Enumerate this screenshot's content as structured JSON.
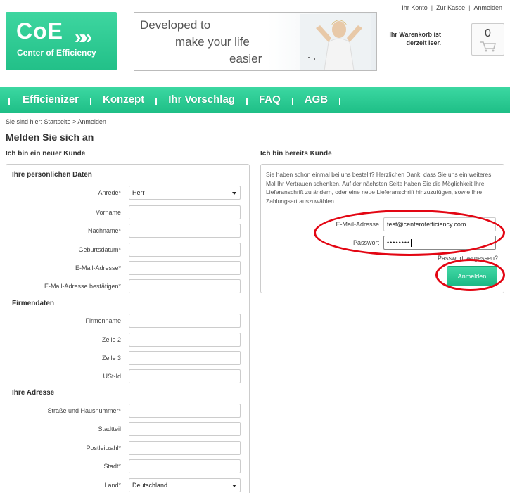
{
  "top_links": [
    "Ihr Konto",
    "Zur Kasse",
    "Anmelden"
  ],
  "logo": {
    "big": "CoE",
    "chevrons": "»»",
    "tagline": "Center of Efficiency"
  },
  "banner": {
    "line1": "Developed to",
    "line2": "make your life",
    "line3": "easier"
  },
  "cart": {
    "line1": "Ihr Warenkorb ist",
    "line2": "derzeit leer.",
    "count": "0"
  },
  "nav": [
    "Efficienizer",
    "Konzept",
    "Ihr Vorschlag",
    "FAQ",
    "AGB"
  ],
  "breadcrumb": {
    "prefix": "Sie sind hier:",
    "home": "Startseite",
    "separator": ">",
    "current": "Anmelden"
  },
  "page_title": "Melden Sie sich an",
  "new_customer": {
    "heading": "Ich bin ein neuer Kunde",
    "personal_title": "Ihre persönlichen Daten",
    "salutation_label": "Anrede*",
    "salutation_value": "Herr",
    "first_name_label": "Vorname",
    "last_name_label": "Nachname*",
    "birthdate_label": "Geburtsdatum*",
    "email_label": "E-Mail-Adresse*",
    "email_confirm_label": "E-Mail-Adresse bestätigen*",
    "company_title": "Firmendaten",
    "company_label": "Firmenname",
    "line2_label": "Zeile 2",
    "line3_label": "Zeile 3",
    "vat_label": "USt-Id",
    "address_title": "Ihre Adresse",
    "street_label": "Straße und Hausnummer*",
    "district_label": "Stadtteil",
    "zip_label": "Postleitzahl*",
    "city_label": "Stadt*",
    "country_label": "Land*",
    "country_value": "Deutschland"
  },
  "existing_customer": {
    "heading": "Ich bin bereits Kunde",
    "intro": "Sie haben schon einmal bei uns bestellt? Herzlichen Dank, dass Sie uns ein weiteres Mal Ihr Vertrauen schenken. Auf der nächsten Seite haben Sie die Möglichkeit Ihre Lieferanschrift zu ändern, oder eine neue Lieferanschrift hinzuzufügen, sowie Ihre Zahlungsart auszuwählen.",
    "email_label": "E-Mail-Adresse",
    "email_value": "test@centerofefficiency.com",
    "password_label": "Passwort",
    "password_value": "••••••••",
    "forgot_label": "Passwort vergessen?",
    "login_button": "Anmelden"
  },
  "colors": {
    "brand": "#22c088",
    "annotation": "#e30613"
  }
}
